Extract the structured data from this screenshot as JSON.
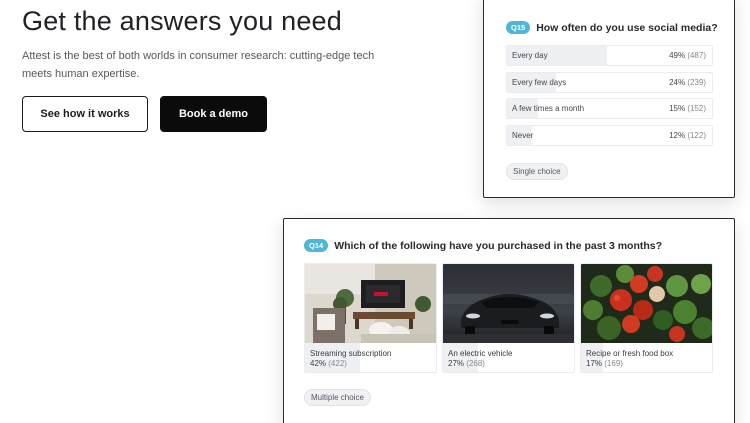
{
  "hero": {
    "title": "Get the answers you need",
    "description": "Attest is the best of both worlds in consumer research: cutting-edge tech meets human expertise.",
    "btn_how": "See how it works",
    "btn_demo": "Book a demo"
  },
  "q15": {
    "badge": "Q15",
    "question": "How often do you use social media?",
    "options": [
      {
        "label": "Every day",
        "pct": "49%",
        "count": "(487)",
        "share": 0.49
      },
      {
        "label": "Every few days",
        "pct": "24%",
        "count": "(239)",
        "share": 0.24
      },
      {
        "label": "A few times a month",
        "pct": "15%",
        "count": "(152)",
        "share": 0.15
      },
      {
        "label": "Never",
        "pct": "12%",
        "count": "(122)",
        "share": 0.12
      }
    ],
    "type_tag": "Single choice"
  },
  "q14": {
    "badge": "Q14",
    "question": "Which of the following have you purchased in the past 3 months?",
    "options": [
      {
        "label": "Streaming subscription",
        "pct": "42%",
        "count": "(422)",
        "share": 0.42,
        "image": "living-room-tv"
      },
      {
        "label": "An electric vehicle",
        "pct": "27%",
        "count": "(268)",
        "share": 0.27,
        "image": "electric-car"
      },
      {
        "label": "Recipe or fresh food box",
        "pct": "17%",
        "count": "(169)",
        "share": 0.17,
        "image": "fresh-vegetables"
      }
    ],
    "type_tag": "Multiple choice"
  },
  "colors": {
    "badge": "#4fb6d6",
    "bar_fill": "#eef0f3",
    "primary_button": "#0b0b0c"
  }
}
